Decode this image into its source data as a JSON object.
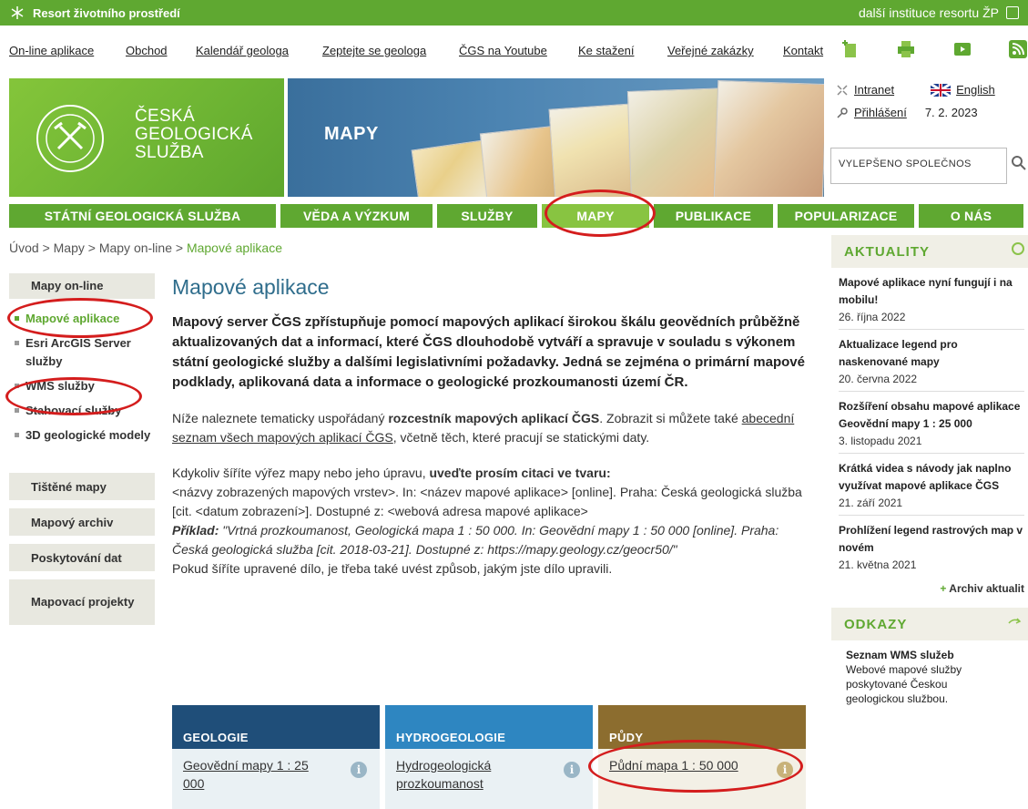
{
  "topbar": {
    "brand": "Resort životního prostředí",
    "right": "další instituce resortu ŽP"
  },
  "links": [
    "On-line aplikace",
    "Obchod",
    "Kalendář geologa",
    "Zeptejte se geologa",
    "ČGS na Youtube",
    "Ke stažení",
    "Veřejné zakázky",
    "Kontakt"
  ],
  "banner": {
    "org_line1": "ČESKÁ",
    "org_line2": "GEOLOGICKÁ",
    "org_line3": "SLUŽBA",
    "section": "MAPY",
    "intranet": "Intranet",
    "english": "English",
    "login": "Přihlášení",
    "date": "7. 2. 2023",
    "search_text": "VYLEPŠENO SPOLEČNOS"
  },
  "nav": [
    "STÁTNÍ GEOLOGICKÁ SLUŽBA",
    "VĚDA A VÝZKUM",
    "SLUŽBY",
    "MAPY",
    "PUBLIKACE",
    "POPULARIZACE",
    "O NÁS"
  ],
  "breadcrumb": {
    "path": "Úvod > Mapy > Mapy on-line > ",
    "current": "Mapové aplikace"
  },
  "leftnav": {
    "head": "Mapy on-line",
    "subs": [
      "Mapové aplikace",
      "Esri ArcGIS Server služby",
      "WMS služby",
      "Stahovací služby",
      "3D geologické modely"
    ],
    "blocks": [
      "Tištěné mapy",
      "Mapový archiv",
      "Poskytování dat",
      "Mapovací projekty"
    ]
  },
  "content": {
    "title": "Mapové aplikace",
    "lead": "Mapový server ČGS zpřístupňuje pomocí mapových aplikací širokou škálu geovědních průběžně aktualizovaných dat a informací, které ČGS dlouhodobě vytváří a spravuje v souladu s výkonem státní geologické služby a dalšími legislativními požadavky. Jedná se zejména o primární mapové podklady, aplikovaná data a informace o geologické prozkoumanosti území ČR.",
    "p1_a": "Níže naleznete tematicky uspořádaný ",
    "p1_b": "rozcestník mapových aplikací ČGS",
    "p1_c": ". Zobrazit si můžete také ",
    "p1_d": "abecední seznam všech mapových aplikací ČGS",
    "p1_e": ", včetně těch, které pracují se statickými daty.",
    "p2_a": "Kdykoliv šíříte výřez mapy nebo jeho úpravu, ",
    "p2_b": "uveďte prosím citaci ve tvaru:",
    "p2_c": "<názvy zobrazených mapových vrstev>. In: <název mapové aplikace> [online]. Praha: Česká geologická služba [cit. <datum zobrazení>]. Dostupné z: <webová adresa mapové aplikace>",
    "p2_ex_label": "Příklad:",
    "p2_ex": " \"Vrtná prozkoumanost, Geologická mapa 1 : 50 000. In: Geovědní mapy 1 : 50 000 [online]. Praha: Česká geologická služba [cit. 2018-03-21]. Dostupné z: https://mapy.geology.cz/geocr50/\"",
    "p3": "Pokud šíříte upravené dílo, je třeba také uvést způsob, jakým jste dílo upravili."
  },
  "tiles": [
    {
      "head": "GEOLOGIE",
      "link": "Geovědní mapy 1 : 25 000",
      "color": "#1f4e79"
    },
    {
      "head": "HYDROGEOLOGIE",
      "link": "Hydrogeologická prozkoumanost",
      "color": "#2e86c1"
    },
    {
      "head": "PŮDY",
      "link": "Půdní mapa 1 : 50 000",
      "color": "#8c6d2f"
    }
  ],
  "sidebar": {
    "news_title": "AKTUALITY",
    "news": [
      {
        "title": "Mapové aplikace nyní fungují i na mobilu!",
        "date": "26. října 2022"
      },
      {
        "title": "Aktualizace legend pro naskenované mapy",
        "date": "20. června 2022"
      },
      {
        "title": "Rozšíření obsahu mapové aplikace Geovědní mapy 1 : 25 000",
        "date": "3. listopadu 2021"
      },
      {
        "title": "Krátká videa s návody jak naplno využívat mapové aplikace ČGS",
        "date": "21. září 2021"
      },
      {
        "title": "Prohlížení legend rastrových map v novém",
        "date": "21. května 2021"
      }
    ],
    "archive": "Archiv aktualit",
    "links_title": "ODKAZY",
    "wms_title": "Seznam WMS služeb",
    "wms_desc": "Webové mapové služby poskytované Českou geologickou službou."
  },
  "colors": {
    "green": "#5fa831",
    "green_active": "#88c441",
    "highlight": "#d41d1d"
  }
}
